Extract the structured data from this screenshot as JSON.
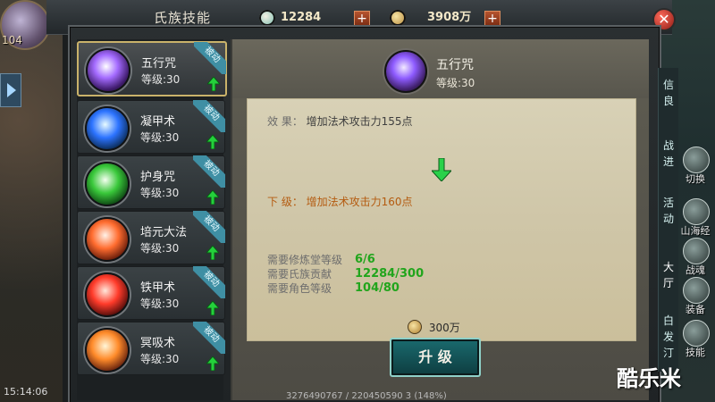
{
  "header": {
    "title": "氏族技能",
    "currency_1": {
      "value": "12284",
      "icon": "jade-coin-icon",
      "plus": "+"
    },
    "currency_2": {
      "value": "3908万",
      "icon": "copper-coin-icon",
      "plus": "+"
    },
    "close": "✕"
  },
  "player": {
    "level": "104",
    "time": "15:14:06"
  },
  "skills": [
    {
      "name": "五行咒",
      "level": "等级:30",
      "tag": "被动",
      "icon": "lightning-orb-icon",
      "active": true
    },
    {
      "name": "凝甲术",
      "level": "等级:30",
      "tag": "被动",
      "icon": "ice-armor-icon",
      "active": false
    },
    {
      "name": "护身咒",
      "level": "等级:30",
      "tag": "被动",
      "icon": "green-aura-icon",
      "active": false
    },
    {
      "name": "培元大法",
      "level": "等级:30",
      "tag": "被动",
      "icon": "meditation-icon",
      "active": false
    },
    {
      "name": "铁甲术",
      "level": "等级:30",
      "tag": "被动",
      "icon": "iron-armor-icon",
      "active": false
    },
    {
      "name": "冥吸术",
      "level": "等级:30",
      "tag": "被动",
      "icon": "shield-flame-icon",
      "active": false
    }
  ],
  "detail": {
    "name": "五行咒",
    "level": "等级:30",
    "effect_label": "效    果：",
    "effect_value": "增加法术攻击力155点",
    "next_label": "下    级：",
    "next_value": "增加法术攻击力160点",
    "requirements": [
      {
        "label": "需要修炼堂等级",
        "value": "6/6"
      },
      {
        "label": "需要氏族贡献",
        "value": "12284/300"
      },
      {
        "label": "需要角色等级",
        "value": "104/80"
      }
    ],
    "cost": "300万",
    "upgrade_button": "升 级"
  },
  "right_panel": {
    "tab_texts": [
      "信",
      "良",
      "战",
      "进",
      "活",
      "动",
      "大",
      "厅",
      "白",
      "发",
      "汀"
    ],
    "buttons": [
      {
        "label": "切换"
      },
      {
        "label": "山海经"
      },
      {
        "label": "战魂"
      },
      {
        "label": "装备"
      },
      {
        "label": "技能"
      }
    ]
  },
  "watermark": "酷乐米",
  "bottom_status": "3276490767 / 220450590 3 (148%)"
}
